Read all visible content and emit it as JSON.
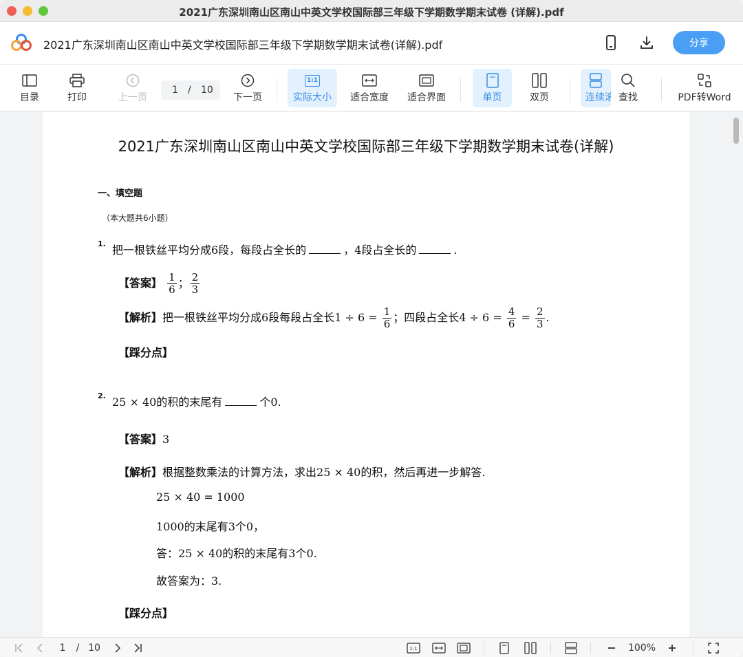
{
  "window": {
    "title": "2021广东深圳南山区南山中英文学校国际部三年级下学期数学期末试卷 (详解).pdf"
  },
  "header": {
    "doc_title": "2021广东深圳南山区南山中英文学校国际部三年级下学期数学期末试卷(详解).pdf",
    "share_label": "分享"
  },
  "toolbar": {
    "toc": "目录",
    "print": "打印",
    "prev": "上一页",
    "page_current": "1",
    "page_sep": "/",
    "page_total": "10",
    "next": "下一页",
    "actual_size": "实际大小",
    "actual_size_glyph": "1:1",
    "fit_width": "适合宽度",
    "fit_page": "适合界面",
    "single": "单页",
    "double": "双页",
    "continuous": "连续滚动",
    "find": "查找",
    "to_word": "PDF转Word"
  },
  "document": {
    "title": "2021广东深圳南山区南山中英文学校国际部三年级下学期数学期末试卷(详解)",
    "section": "一、填空题",
    "note": "（本大题共6小题）",
    "q1": {
      "num": "1.",
      "text_a": "把一根铁丝平均分成6段，每段占全长的",
      "text_b": "，4段占全长的",
      "text_c": ".",
      "answer_label": "【答案】",
      "ans1_num": "1",
      "ans1_den": "6",
      "ans_sep": "；",
      "ans2_num": "2",
      "ans2_den": "3",
      "analysis_label": "【解析】",
      "analysis_a": "把一根铁丝平均分成6段每段占全长1 ÷ 6 =",
      "a_f1_num": "1",
      "a_f1_den": "6",
      "analysis_b": "；四段占全长4 ÷ 6 =",
      "a_f2_num": "4",
      "a_f2_den": "6",
      "analysis_eq": "=",
      "a_f3_num": "2",
      "a_f3_den": "3",
      "analysis_end": ".",
      "points_label": "【踩分点】"
    },
    "q2": {
      "num": "2.",
      "text_a": "25 × 40的积的末尾有",
      "text_b": "个0.",
      "answer_label": "【答案】",
      "answer": "3",
      "analysis_label": "【解析】",
      "analysis": "根据整数乘法的计算方法，求出25 × 40的积，然后再进一步解答.",
      "steps": [
        "25 × 40 = 1000",
        "1000的末尾有3个0，",
        "答：25 × 40的积的末尾有3个0.",
        "故答案为：3."
      ],
      "points_label": "【踩分点】"
    }
  },
  "bottom": {
    "page_current": "1",
    "page_sep": "/",
    "page_total": "10",
    "zoom": "100%"
  }
}
